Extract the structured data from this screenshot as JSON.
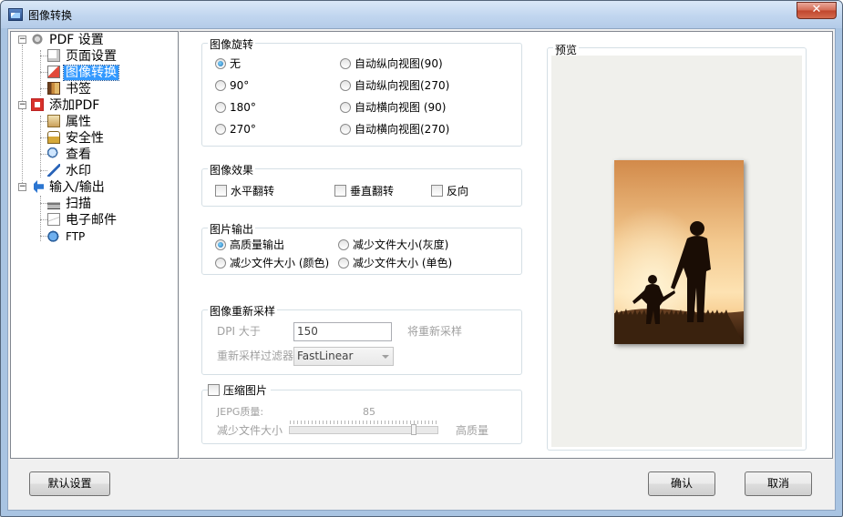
{
  "window": {
    "title": "图像转换",
    "close_glyph": "✕"
  },
  "tree": {
    "items": [
      {
        "label": "PDF 设置",
        "icon": "pdf-settings-icon",
        "level": 0
      },
      {
        "label": "页面设置",
        "icon": "page-setup-icon",
        "level": 1
      },
      {
        "label": "图像转换",
        "icon": "image-convert-icon",
        "level": 1,
        "selected": true
      },
      {
        "label": "书签",
        "icon": "bookmark-icon",
        "level": 1
      },
      {
        "label": "添加PDF",
        "icon": "add-pdf-icon",
        "level": 0
      },
      {
        "label": "属性",
        "icon": "properties-icon",
        "level": 1
      },
      {
        "label": "安全性",
        "icon": "lock-icon",
        "level": 1
      },
      {
        "label": "查看",
        "icon": "magnifier-icon",
        "level": 1
      },
      {
        "label": "水印",
        "icon": "watermark-icon",
        "level": 1
      },
      {
        "label": "输入/输出",
        "icon": "arrow-left-icon",
        "level": 0
      },
      {
        "label": "扫描",
        "icon": "scanner-icon",
        "level": 1
      },
      {
        "label": "电子邮件",
        "icon": "envelope-icon",
        "level": 1
      },
      {
        "label": "FTP",
        "icon": "ftp-icon",
        "level": 1
      }
    ]
  },
  "rotation": {
    "title": "图像旋转",
    "options": [
      {
        "label": "无",
        "checked": true
      },
      {
        "label": "自动纵向视图(90)",
        "checked": false
      },
      {
        "label": "90°",
        "checked": false
      },
      {
        "label": "自动纵向视图(270)",
        "checked": false
      },
      {
        "label": "180°",
        "checked": false
      },
      {
        "label": "自动横向视图 (90)",
        "checked": false
      },
      {
        "label": "270°",
        "checked": false
      },
      {
        "label": "自动横向视图(270)",
        "checked": false
      }
    ]
  },
  "effects": {
    "title": "图像效果",
    "options": [
      {
        "label": "水平翻转",
        "checked": false
      },
      {
        "label": "垂直翻转",
        "checked": false
      },
      {
        "label": "反向",
        "checked": false
      }
    ]
  },
  "output": {
    "title": "图片输出",
    "options": [
      {
        "label": "高质量输出",
        "checked": true
      },
      {
        "label": "减少文件大小(灰度)",
        "checked": false
      },
      {
        "label": "减少文件大小 (颜色)",
        "checked": false
      },
      {
        "label": "减少文件大小 (单色)",
        "checked": false
      }
    ]
  },
  "resample": {
    "title": "图像重新采样",
    "dpi_label": "DPI 大于",
    "dpi_value": "150",
    "dpi_suffix": "将重新采样",
    "filter_label": "重新采样过滤器",
    "filter_value": "FastLinear"
  },
  "compress": {
    "checkbox_label": "压缩图片",
    "checked": false,
    "quality_label": "JEPG质量:",
    "quality_value": "85",
    "slider_min_label": "减少文件大小",
    "slider_max_label": "高质量",
    "slider_fraction": 0.85
  },
  "preview": {
    "title": "预览"
  },
  "buttons": {
    "default": "默认设置",
    "ok": "确认",
    "cancel": "取消"
  }
}
